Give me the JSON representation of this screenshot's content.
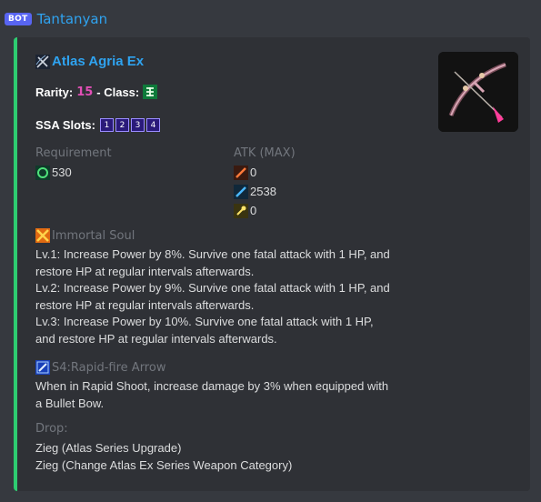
{
  "header": {
    "bot_tag": "BOT",
    "bot_name": "Tantanyan"
  },
  "embed": {
    "accent_color": "#2ecc71",
    "title": "Atlas Agria Ex",
    "rarity_label": "Rarity:",
    "rarity_value": "15",
    "class_label": "- Class:",
    "ssa_label": "SSA Slots:",
    "ssa_slots": [
      "1",
      "2",
      "3",
      "4"
    ],
    "requirement_label": "Requirement",
    "requirement_value": "530",
    "atk_label": "ATK (MAX)",
    "atk_values": [
      "0",
      "2538",
      "0"
    ],
    "ability_name": "Immortal Soul",
    "ability_lines": [
      "Lv.1: Increase Power by 8%. Survive one fatal attack with 1 HP, and",
      "restore HP at regular intervals afterwards.",
      "Lv.2: Increase Power by 9%. Survive one fatal attack with 1 HP, and",
      "restore HP at regular intervals afterwards.",
      "Lv.3: Increase Power by 10%. Survive one fatal attack with 1 HP,",
      "and restore HP at regular intervals afterwards."
    ],
    "s4_name": "S4:Rapid-fire Arrow",
    "s4_lines": [
      "When in Rapid Shoot, increase damage by 3% when equipped with",
      "a Bullet Bow."
    ],
    "drop_label": "Drop:",
    "drop_lines": [
      "Zieg (Atlas Series Upgrade)",
      "Zieg (Change Atlas Ex Series Weapon Category)"
    ]
  }
}
